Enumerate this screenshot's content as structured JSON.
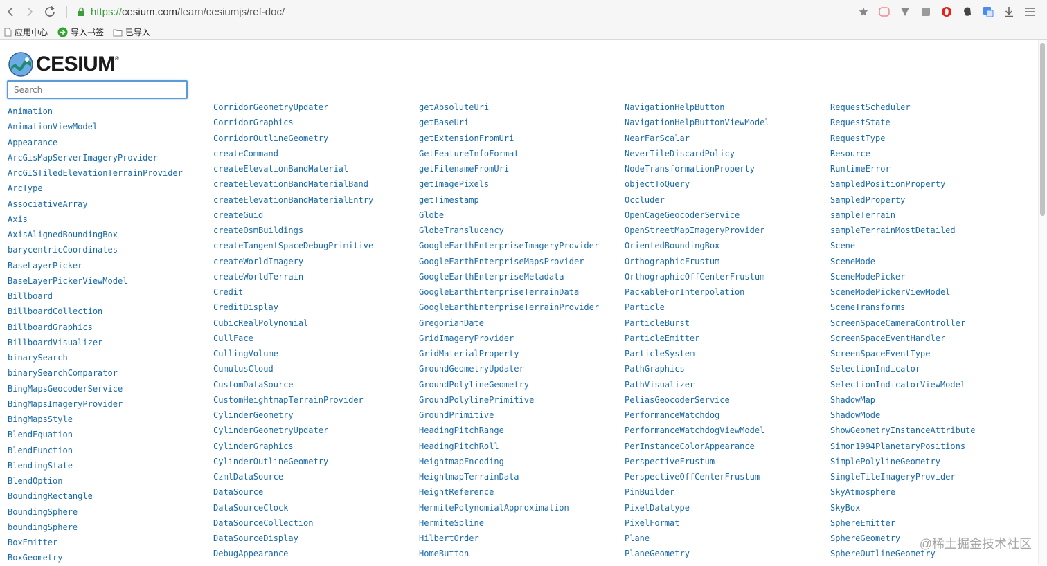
{
  "browser": {
    "url_scheme": "https://",
    "url_host": "cesium.com",
    "url_path": "/learn/cesiumjs/ref-doc/"
  },
  "bookmarks": [
    {
      "label": "应用中心",
      "icon": "document-icon"
    },
    {
      "label": "导入书签",
      "icon": "green-arrow-icon"
    },
    {
      "label": "已导入",
      "icon": "folder-icon"
    }
  ],
  "logo": {
    "text": "CESIUM",
    "reg": "®"
  },
  "search": {
    "placeholder": "Search"
  },
  "columns": [
    [
      "Animation",
      "AnimationViewModel",
      "Appearance",
      "ArcGisMapServerImageryProvider",
      "ArcGISTiledElevationTerrainProvider",
      "ArcType",
      "AssociativeArray",
      "Axis",
      "AxisAlignedBoundingBox",
      "barycentricCoordinates",
      "BaseLayerPicker",
      "BaseLayerPickerViewModel",
      "Billboard",
      "BillboardCollection",
      "BillboardGraphics",
      "BillboardVisualizer",
      "binarySearch",
      "binarySearchComparator",
      "BingMapsGeocoderService",
      "BingMapsImageryProvider",
      "BingMapsStyle",
      "BlendEquation",
      "BlendFunction",
      "BlendingState",
      "BlendOption",
      "BoundingRectangle",
      "BoundingSphere",
      "boundingSphere",
      "BoxEmitter",
      "BoxGeometry"
    ],
    [
      "CorridorGeometryUpdater",
      "CorridorGraphics",
      "CorridorOutlineGeometry",
      "createCommand",
      "createElevationBandMaterial",
      "createElevationBandMaterialBand",
      "createElevationBandMaterialEntry",
      "createGuid",
      "createOsmBuildings",
      "createTangentSpaceDebugPrimitive",
      "createWorldImagery",
      "createWorldTerrain",
      "Credit",
      "CreditDisplay",
      "CubicRealPolynomial",
      "CullFace",
      "CullingVolume",
      "CumulusCloud",
      "CustomDataSource",
      "CustomHeightmapTerrainProvider",
      "CylinderGeometry",
      "CylinderGeometryUpdater",
      "CylinderGraphics",
      "CylinderOutlineGeometry",
      "CzmlDataSource",
      "DataSource",
      "DataSourceClock",
      "DataSourceCollection",
      "DataSourceDisplay",
      "DebugAppearance"
    ],
    [
      "getAbsoluteUri",
      "getBaseUri",
      "getExtensionFromUri",
      "GetFeatureInfoFormat",
      "getFilenameFromUri",
      "getImagePixels",
      "getTimestamp",
      "Globe",
      "GlobeTranslucency",
      "GoogleEarthEnterpriseImageryProvider",
      "GoogleEarthEnterpriseMapsProvider",
      "GoogleEarthEnterpriseMetadata",
      "GoogleEarthEnterpriseTerrainData",
      "GoogleEarthEnterpriseTerrainProvider",
      "GregorianDate",
      "GridImageryProvider",
      "GridMaterialProperty",
      "GroundGeometryUpdater",
      "GroundPolylineGeometry",
      "GroundPolylinePrimitive",
      "GroundPrimitive",
      "HeadingPitchRange",
      "HeadingPitchRoll",
      "HeightmapEncoding",
      "HeightmapTerrainData",
      "HeightReference",
      "HermitePolynomialApproximation",
      "HermiteSpline",
      "HilbertOrder",
      "HomeButton"
    ],
    [
      "NavigationHelpButton",
      "NavigationHelpButtonViewModel",
      "NearFarScalar",
      "NeverTileDiscardPolicy",
      "NodeTransformationProperty",
      "objectToQuery",
      "Occluder",
      "OpenCageGeocoderService",
      "OpenStreetMapImageryProvider",
      "OrientedBoundingBox",
      "OrthographicFrustum",
      "OrthographicOffCenterFrustum",
      "PackableForInterpolation",
      "Particle",
      "ParticleBurst",
      "ParticleEmitter",
      "ParticleSystem",
      "PathGraphics",
      "PathVisualizer",
      "PeliasGeocoderService",
      "PerformanceWatchdog",
      "PerformanceWatchdogViewModel",
      "PerInstanceColorAppearance",
      "PerspectiveFrustum",
      "PerspectiveOffCenterFrustum",
      "PinBuilder",
      "PixelDatatype",
      "PixelFormat",
      "Plane",
      "PlaneGeometry"
    ],
    [
      "RequestScheduler",
      "RequestState",
      "RequestType",
      "Resource",
      "RuntimeError",
      "SampledPositionProperty",
      "SampledProperty",
      "sampleTerrain",
      "sampleTerrainMostDetailed",
      "Scene",
      "SceneMode",
      "SceneModePicker",
      "SceneModePickerViewModel",
      "SceneTransforms",
      "ScreenSpaceCameraController",
      "ScreenSpaceEventHandler",
      "ScreenSpaceEventType",
      "SelectionIndicator",
      "SelectionIndicatorViewModel",
      "ShadowMap",
      "ShadowMode",
      "ShowGeometryInstanceAttribute",
      "Simon1994PlanetaryPositions",
      "SimplePolylineGeometry",
      "SingleTileImageryProvider",
      "SkyAtmosphere",
      "SkyBox",
      "SphereEmitter",
      "SphereGeometry",
      "SphereOutlineGeometry"
    ]
  ],
  "watermark": "@稀土掘金技术社区",
  "colors": {
    "link": "#1a6aa8",
    "accent": "#5b9bd8",
    "url_secure": "#3a9c3a"
  }
}
